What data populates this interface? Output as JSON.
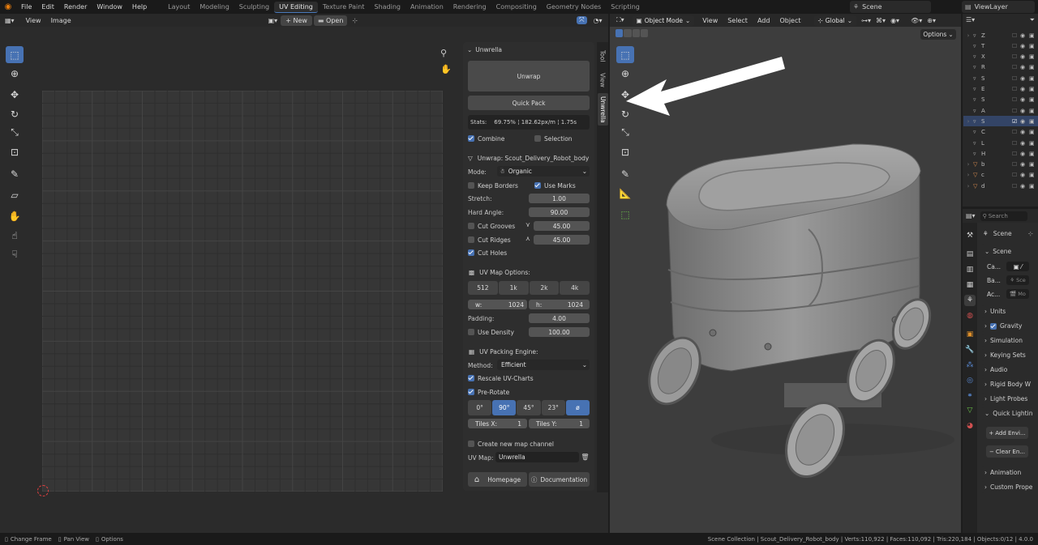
{
  "topbar": {
    "menus": [
      "File",
      "Edit",
      "Render",
      "Window",
      "Help"
    ],
    "workspaces": [
      "Layout",
      "Modeling",
      "Sculpting",
      "UV Editing",
      "Texture Paint",
      "Shading",
      "Animation",
      "Rendering",
      "Compositing",
      "Geometry Nodes",
      "Scripting"
    ],
    "active_workspace": "UV Editing",
    "scene": "Scene",
    "view_layer": "ViewLayer"
  },
  "uv_editor": {
    "menus": [
      "View",
      "Image"
    ],
    "new_label": "New",
    "open_label": "Open"
  },
  "unwrella": {
    "panel_title": "Unwrella",
    "unwrap_button": "Unwrap",
    "quick_pack_button": "Quick Pack",
    "stats_label": "Stats:",
    "stats_value": "69.75% ¦ 182.62px/m ¦ 1.75s",
    "combine_label": "Combine",
    "selection_label": "Selection",
    "unwrap_title": "Unwrap: Scout_Delivery_Robot_body",
    "mode_label": "Mode:",
    "mode_value": "Organic",
    "keep_borders_label": "Keep Borders",
    "use_marks_label": "Use Marks",
    "stretch_label": "Stretch:",
    "stretch_value": "1.00",
    "hard_angle_label": "Hard Angle:",
    "hard_angle_value": "90.00",
    "cut_grooves_label": "Cut Grooves",
    "cut_grooves_value": "45.00",
    "cut_ridges_label": "Cut Ridges",
    "cut_ridges_value": "45.00",
    "cut_holes_label": "Cut Holes",
    "uv_map_options_title": "UV Map Options:",
    "resolutions": [
      "512",
      "1k",
      "2k",
      "4k"
    ],
    "w_label": "w:",
    "w_value": "1024",
    "h_label": "h:",
    "h_value": "1024",
    "padding_label": "Padding:",
    "padding_value": "4.00",
    "use_density_label": "Use Density",
    "density_value": "100.00",
    "packing_engine_title": "UV Packing Engine:",
    "method_label": "Method:",
    "method_value": "Efficient",
    "rescale_label": "Rescale UV-Charts",
    "prerotate_label": "Pre-Rotate",
    "rotations": [
      "0°",
      "90°",
      "45°",
      "23°",
      "ø"
    ],
    "tiles_x_label": "Tiles X:",
    "tiles_x_value": "1",
    "tiles_y_label": "Tiles Y:",
    "tiles_y_value": "1",
    "new_map_channel_label": "Create new map channel",
    "uv_map_label": "UV Map:",
    "uv_map_value": "Unwrella",
    "homepage_label": "Homepage",
    "documentation_label": "Documentation"
  },
  "side_tabs": [
    "Tool",
    "View",
    "Unwrella"
  ],
  "viewport": {
    "mode": "Object Mode",
    "menus": [
      "View",
      "Select",
      "Add",
      "Object"
    ],
    "orientation": "Global",
    "options_label": "Options"
  },
  "outliner": {
    "rows": [
      "Z",
      "T",
      "X",
      "R",
      "S",
      "E",
      "S",
      "A",
      "S",
      "C",
      "L",
      "H",
      "b",
      "c",
      "d"
    ]
  },
  "properties": {
    "search_placeholder": "Search",
    "scene_header": "Scene",
    "scene_section": "Scene",
    "camera_label": "Ca...",
    "background_label": "Ba...",
    "background_value": "Sce",
    "active_clip_label": "Ac...",
    "active_clip_value": "Mo",
    "sections": [
      "Units",
      "Gravity",
      "Simulation",
      "Keying Sets",
      "Audio",
      "Rigid Body W",
      "Light Probes",
      "Quick Lighting"
    ],
    "add_env_label": "Add Envi...",
    "clear_env_label": "Clear En...",
    "sections_bottom": [
      "Animation",
      "Custom Prope"
    ]
  },
  "statusbar": {
    "change_frame": "Change Frame",
    "pan_view": "Pan View",
    "options": "Options",
    "info": "Scene Collection | Scout_Delivery_Robot_body | Verts:110,922 | Faces:110,092 | Tris:220,184 | Objects:0/12 | 4.0.0"
  },
  "colors": {
    "accent": "#4772b3",
    "background": "#1d1d1d",
    "viewport_bg": "#3d3d3d"
  }
}
